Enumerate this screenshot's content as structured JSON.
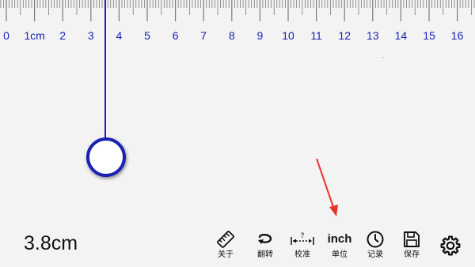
{
  "ruler": {
    "unit_label": "1cm",
    "tick_numbers": [
      "0",
      "1cm",
      "2",
      "3",
      "4",
      "5",
      "6",
      "7",
      "8",
      "9",
      "10",
      "11",
      "12",
      "13",
      "14",
      "15",
      "16"
    ],
    "accent_color": "#1a22b5"
  },
  "measurement": {
    "value": "3.8cm"
  },
  "toolbar": {
    "about_label": "关于",
    "flip_label": "翻转",
    "calibrate_label": "校准",
    "unit_label": "单位",
    "unit_value": "inch",
    "history_label": "记录",
    "save_label": "保存",
    "calibrate_hint": "?"
  },
  "icons": {
    "about": "ruler-icon",
    "flip": "rotate-icon",
    "calibrate": "calibrate-icon",
    "history": "clock-icon",
    "save": "floppy-disk-icon",
    "settings": "gear-icon"
  },
  "annotation": {
    "arrow_color": "#e8332a"
  }
}
